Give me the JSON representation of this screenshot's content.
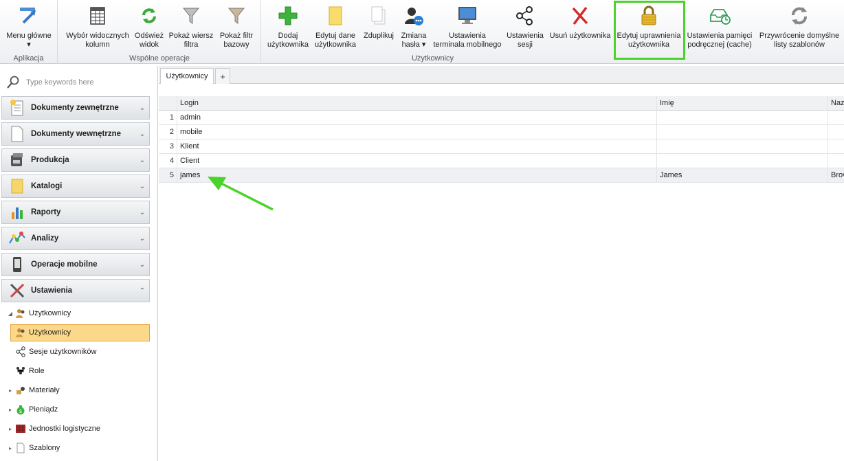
{
  "ribbon": {
    "groups": [
      {
        "caption": "Aplikacja",
        "buttons": [
          {
            "label": "Menu główne\n▾",
            "icon": "main-menu-icon"
          }
        ]
      },
      {
        "caption": "Wspólne operacje",
        "buttons": [
          {
            "label": "Wybór widocznych\nkolumn",
            "icon": "column-chooser-icon"
          },
          {
            "label": "Odśwież\nwidok",
            "icon": "refresh-icon"
          },
          {
            "label": "Pokaż wiersz\nfiltra",
            "icon": "filter-row-icon"
          },
          {
            "label": "Pokaż filtr\nbazowy",
            "icon": "base-filter-icon"
          }
        ]
      },
      {
        "caption": "Użytkownicy",
        "buttons": [
          {
            "label": "Dodaj\nużytkownika",
            "icon": "add-icon"
          },
          {
            "label": "Edytuj dane\nużytkownika",
            "icon": "edit-icon"
          },
          {
            "label": "Zduplikuj",
            "icon": "duplicate-icon"
          },
          {
            "label": "Zmiana\nhasła ▾",
            "icon": "change-password-icon"
          },
          {
            "label": "Ustawienia\nterminala mobilnego",
            "icon": "mobile-terminal-icon"
          },
          {
            "label": "Ustawienia\nsesji",
            "icon": "session-icon"
          },
          {
            "label": "Usuń użytkownika",
            "icon": "delete-icon"
          },
          {
            "label": "Edytuj uprawnienia\nużytkownika",
            "icon": "lock-icon"
          },
          {
            "label": "Ustawienia pamięci\npodręcznej (cache)",
            "icon": "cache-icon"
          },
          {
            "label": "Przywrócenie domyślne\nlisty szablonów",
            "icon": "restore-icon"
          }
        ]
      }
    ]
  },
  "sidebar": {
    "search_placeholder": "Type keywords here",
    "panels": [
      {
        "label": "Dokumenty zewnętrzne",
        "chevron": "⌄"
      },
      {
        "label": "Dokumenty wewnętrzne",
        "chevron": "⌄"
      },
      {
        "label": "Produkcja",
        "chevron": "⌄"
      },
      {
        "label": "Katalogi",
        "chevron": "⌄"
      },
      {
        "label": "Raporty",
        "chevron": "⌄"
      },
      {
        "label": "Analizy",
        "chevron": "⌄"
      },
      {
        "label": "Operacje mobilne",
        "chevron": "⌄"
      },
      {
        "label": "Ustawienia",
        "chevron": "⌃"
      }
    ],
    "tree": [
      {
        "label": "Użytkownicy",
        "arrow": "◢"
      },
      {
        "label": "Użytkownicy",
        "arrow": ""
      },
      {
        "label": "Sesje użytkowników",
        "arrow": ""
      },
      {
        "label": "Role",
        "arrow": ""
      },
      {
        "label": "Materiały",
        "arrow": "▸"
      },
      {
        "label": "Pieniądz",
        "arrow": "▸"
      },
      {
        "label": "Jednostki logistyczne",
        "arrow": "▸"
      },
      {
        "label": "Szablony",
        "arrow": "▸"
      }
    ]
  },
  "main": {
    "tabs": [
      {
        "label": "Użytkownicy"
      },
      {
        "label": "+"
      }
    ],
    "grid": {
      "columns": [
        "Login",
        "Imię",
        "Naz"
      ],
      "rows": [
        {
          "num": "1",
          "login": "admin",
          "imie": "",
          "naz": ""
        },
        {
          "num": "2",
          "login": "mobile",
          "imie": "",
          "naz": ""
        },
        {
          "num": "3",
          "login": "Klient",
          "imie": "",
          "naz": ""
        },
        {
          "num": "4",
          "login": "Client",
          "imie": "",
          "naz": ""
        },
        {
          "num": "5",
          "login": "james",
          "imie": "James",
          "naz": "Brov"
        }
      ]
    }
  },
  "colors": {
    "highlight": "#4bd32a",
    "selected_item": "#fcd98a",
    "annotation_arrow": "#4bd32a"
  }
}
